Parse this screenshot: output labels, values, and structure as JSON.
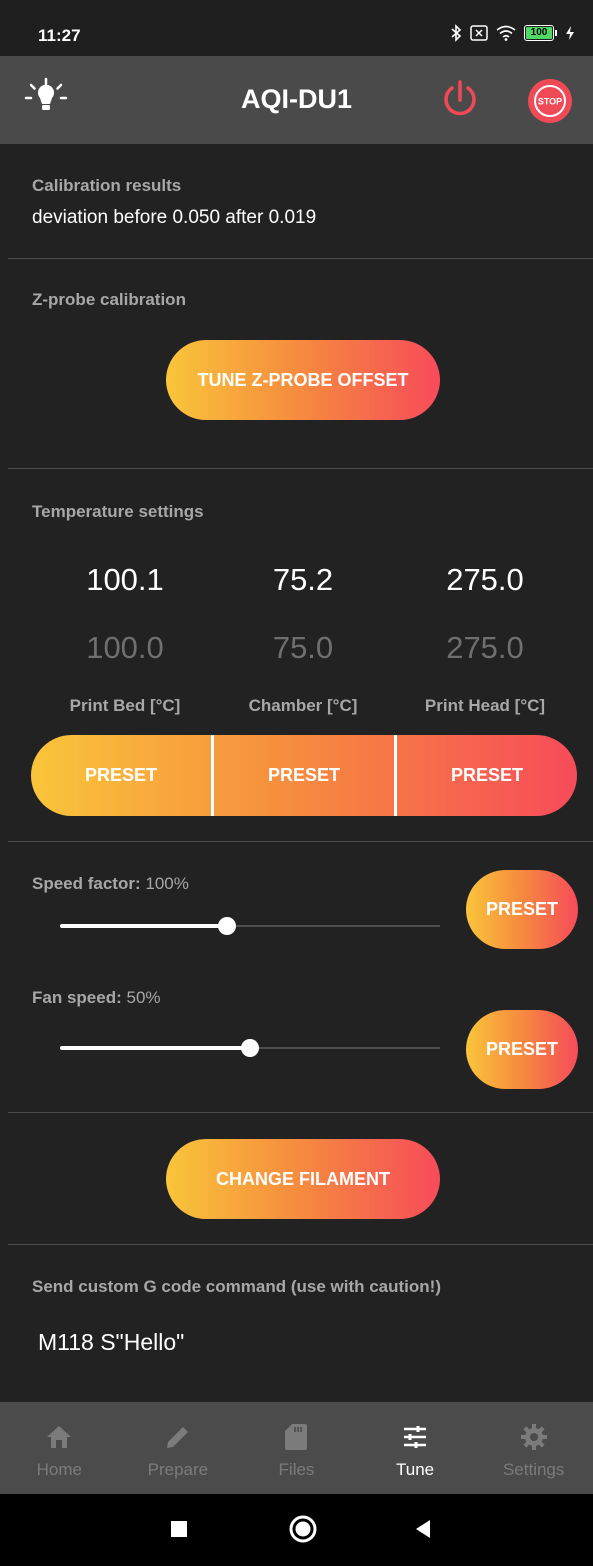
{
  "status_bar": {
    "time": "11:27",
    "battery": "100"
  },
  "app_bar": {
    "title": "AQI-DU1",
    "stop_label": "STOP"
  },
  "calibration": {
    "title": "Calibration results",
    "text": "deviation before 0.050 after 0.019"
  },
  "zprobe": {
    "title": "Z-probe calibration",
    "button": "TUNE Z-PROBE OFFSET"
  },
  "temperature": {
    "title": "Temperature settings",
    "columns": [
      {
        "actual": "100.1",
        "target": "100.0",
        "label": "Print Bed [°C]"
      },
      {
        "actual": "75.2",
        "target": "75.0",
        "label": "Chamber [°C]"
      },
      {
        "actual": "275.0",
        "target": "275.0",
        "label": "Print Head [°C]"
      }
    ],
    "presets": [
      "PRESET",
      "PRESET",
      "PRESET"
    ]
  },
  "speed": {
    "label": "Speed factor:",
    "value": "100%",
    "level": 0.44,
    "preset": "PRESET"
  },
  "fan": {
    "label": "Fan speed:",
    "value": "50%",
    "level": 0.5,
    "preset": "PRESET"
  },
  "filament": {
    "button": "CHANGE FILAMENT"
  },
  "gcode": {
    "title": "Send custom G code command (use with caution!)",
    "value": "M118 S\"Hello\""
  },
  "bottom_nav": {
    "items": [
      {
        "label": "Home",
        "icon": "home-icon"
      },
      {
        "label": "Prepare",
        "icon": "pencil-icon"
      },
      {
        "label": "Files",
        "icon": "sd-card-icon"
      },
      {
        "label": "Tune",
        "icon": "tune-icon",
        "active": true
      },
      {
        "label": "Settings",
        "icon": "gear-icon"
      }
    ]
  },
  "colors": {
    "background": "#222222",
    "app_bar": "#4a4a4a",
    "gradient_start": "#f9c53a",
    "gradient_end": "#f74b5a",
    "accent_red": "#f14a57"
  }
}
